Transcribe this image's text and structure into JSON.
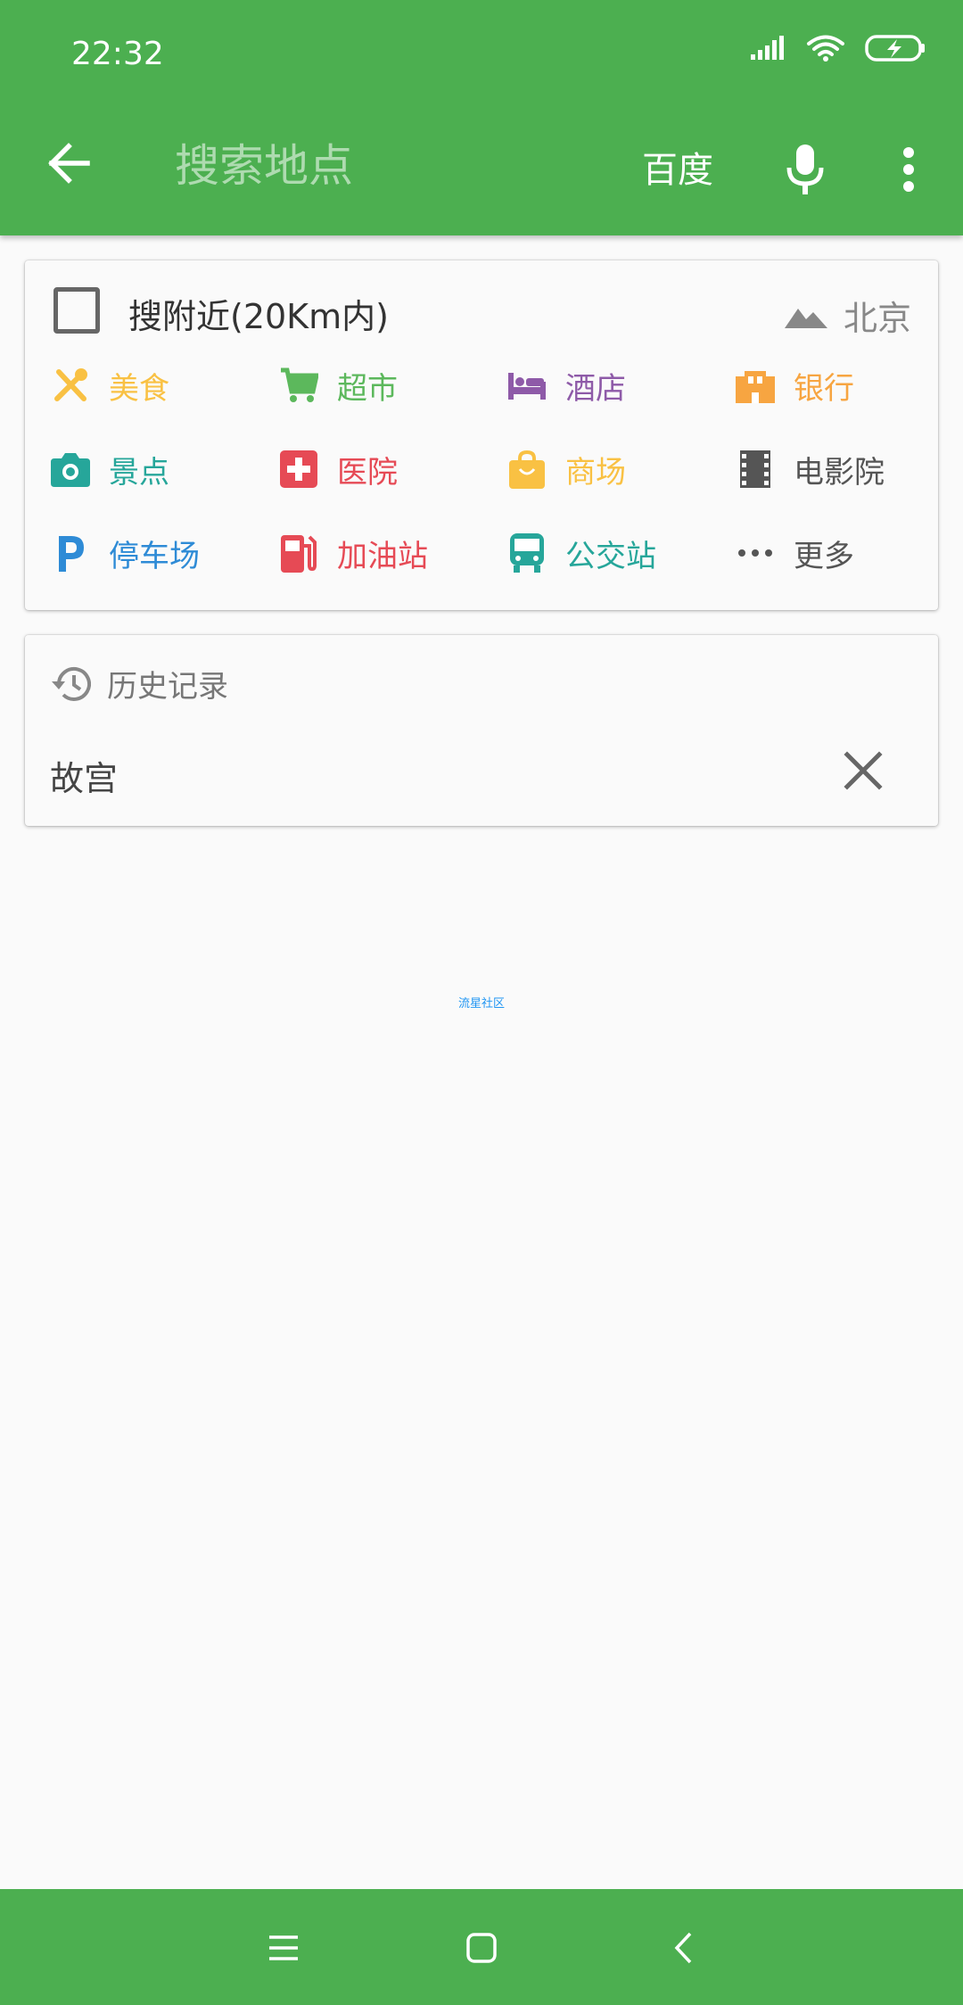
{
  "status_bar": {
    "time": "22:32"
  },
  "header": {
    "search_placeholder": "搜索地点",
    "engine_label": "百度"
  },
  "nearby": {
    "label": "搜附近(20Km内)",
    "checked": false,
    "city": "北京"
  },
  "categories": [
    {
      "label": "美食",
      "icon": "fork-spoon-icon",
      "color": "#f9c143"
    },
    {
      "label": "超市",
      "icon": "cart-icon",
      "color": "#5cb85c"
    },
    {
      "label": "酒店",
      "icon": "bed-icon",
      "color": "#8e5aa8"
    },
    {
      "label": "银行",
      "icon": "bank-24h-icon",
      "color": "#f7a541"
    },
    {
      "label": "景点",
      "icon": "camera-icon",
      "color": "#26a69a"
    },
    {
      "label": "医院",
      "icon": "hospital-icon",
      "color": "#e64a55"
    },
    {
      "label": "商场",
      "icon": "shopping-bag-icon",
      "color": "#f9c143"
    },
    {
      "label": "电影院",
      "icon": "film-icon",
      "color": "#555555"
    },
    {
      "label": "停车场",
      "icon": "parking-icon",
      "color": "#2e8bd6"
    },
    {
      "label": "加油站",
      "icon": "gas-station-icon",
      "color": "#e64a55"
    },
    {
      "label": "公交站",
      "icon": "bus-icon",
      "color": "#26a69a"
    },
    {
      "label": "更多",
      "icon": "more-dots-icon",
      "color": "#555555"
    }
  ],
  "history": {
    "title": "历史记录",
    "items": [
      {
        "label": "故宫"
      }
    ]
  },
  "watermark": "流星社区",
  "colors": {
    "primary": "#4caf50",
    "background": "#fafafa"
  }
}
